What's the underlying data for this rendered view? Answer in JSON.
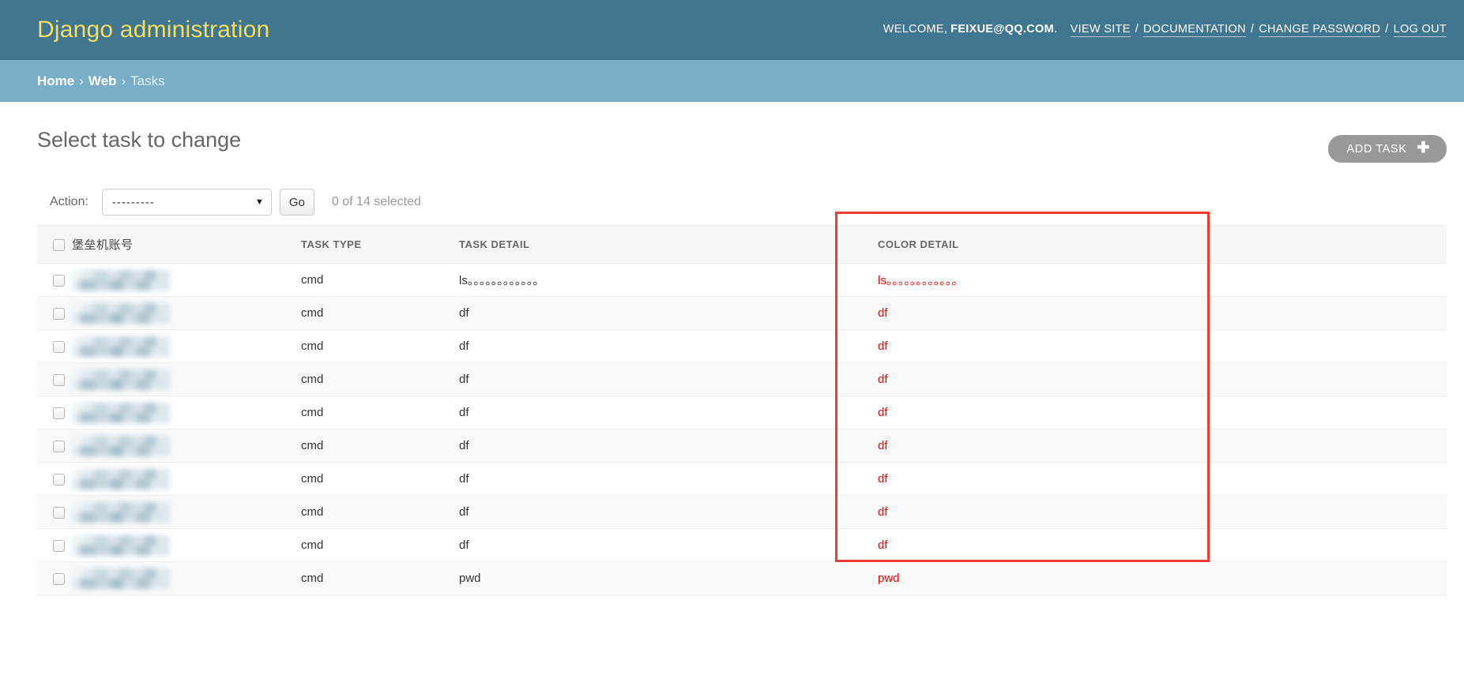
{
  "header": {
    "branding": "Django administration",
    "welcome_word": "WELCOME,",
    "username": "FEIXUE@QQ.COM",
    "period": ".",
    "links": [
      {
        "label": "VIEW SITE"
      },
      {
        "label": "DOCUMENTATION"
      },
      {
        "label": "CHANGE PASSWORD"
      },
      {
        "label": "LOG OUT"
      }
    ],
    "separator": "/"
  },
  "breadcrumbs": {
    "home": "Home",
    "app": "Web",
    "current": "Tasks",
    "separator": "›"
  },
  "page": {
    "title": "Select task to change",
    "add_button_label": "ADD TASK",
    "add_button_icon": "plus-icon"
  },
  "toolbar": {
    "action_label": "Action:",
    "action_selected": "---------",
    "action_options": [
      "---------"
    ],
    "go_label": "Go",
    "selection_counter": "0 of 14 selected",
    "dropdown_icon": "chevron-down-icon"
  },
  "table": {
    "columns": [
      {
        "key": "check",
        "label": ""
      },
      {
        "key": "user",
        "label": "堡垒机账号"
      },
      {
        "key": "type",
        "label": "TASK TYPE"
      },
      {
        "key": "detail",
        "label": "TASK DETAIL"
      },
      {
        "key": "color",
        "label": "COLOR DETAIL"
      }
    ],
    "rows": [
      {
        "user": "",
        "type": "cmd",
        "detail": "ls。。。。。。。。。。。。",
        "color": "ls。。。。。。。。。。。。"
      },
      {
        "user": "",
        "type": "cmd",
        "detail": "df",
        "color": "df"
      },
      {
        "user": "",
        "type": "cmd",
        "detail": "df",
        "color": "df"
      },
      {
        "user": "",
        "type": "cmd",
        "detail": "df",
        "color": "df"
      },
      {
        "user": "",
        "type": "cmd",
        "detail": "df",
        "color": "df"
      },
      {
        "user": "",
        "type": "cmd",
        "detail": "df",
        "color": "df"
      },
      {
        "user": "",
        "type": "cmd",
        "detail": "df",
        "color": "df"
      },
      {
        "user": "",
        "type": "cmd",
        "detail": "df",
        "color": "df"
      },
      {
        "user": "",
        "type": "cmd",
        "detail": "df",
        "color": "df"
      },
      {
        "user": "",
        "type": "cmd",
        "detail": "pwd",
        "color": "pwd"
      }
    ]
  },
  "colors": {
    "header_bg": "#417690",
    "breadcrumb_bg": "#79aec8",
    "brand_text": "#f5dd5d",
    "color_detail_text": "#ff0000",
    "annotation_border": "#f33b32",
    "add_button_bg": "#999999"
  },
  "annotation": {
    "shape": "rectangle-highlight",
    "target_column": "COLOR DETAIL"
  }
}
